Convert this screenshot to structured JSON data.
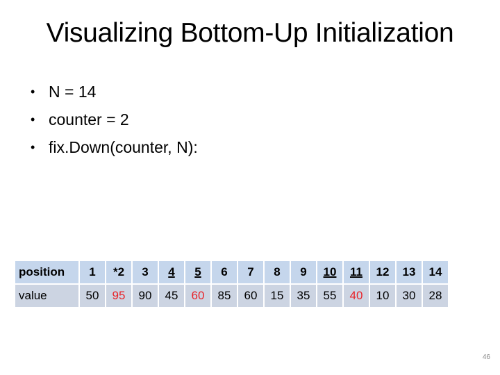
{
  "slide": {
    "title": "Visualizing Bottom-Up Initialization",
    "bullets": [
      "N = 14",
      "counter = 2",
      "fix.Down(counter, N):"
    ],
    "page_number": "46"
  },
  "table": {
    "row_labels": {
      "position": "position",
      "value": "value"
    },
    "positions": [
      {
        "label": "1",
        "underline": false
      },
      {
        "label": "*2",
        "underline": false
      },
      {
        "label": "3",
        "underline": false
      },
      {
        "label": "4",
        "underline": true
      },
      {
        "label": "5",
        "underline": true
      },
      {
        "label": "6",
        "underline": false
      },
      {
        "label": "7",
        "underline": false
      },
      {
        "label": "8",
        "underline": false
      },
      {
        "label": "9",
        "underline": false
      },
      {
        "label": "10",
        "underline": true
      },
      {
        "label": "11",
        "underline": true
      },
      {
        "label": "12",
        "underline": false
      },
      {
        "label": "13",
        "underline": false
      },
      {
        "label": "14",
        "underline": false
      }
    ],
    "values": [
      {
        "v": "50",
        "highlight": false
      },
      {
        "v": "95",
        "highlight": true
      },
      {
        "v": "90",
        "highlight": false
      },
      {
        "v": "45",
        "highlight": false
      },
      {
        "v": "60",
        "highlight": true
      },
      {
        "v": "85",
        "highlight": false
      },
      {
        "v": "60",
        "highlight": false
      },
      {
        "v": "15",
        "highlight": false
      },
      {
        "v": "35",
        "highlight": false
      },
      {
        "v": "55",
        "highlight": false
      },
      {
        "v": "40",
        "highlight": true
      },
      {
        "v": "10",
        "highlight": false
      },
      {
        "v": "30",
        "highlight": false
      },
      {
        "v": "28",
        "highlight": false
      }
    ],
    "colors": {
      "header_bg": "#c5d6ec",
      "row_bg": "#ccd4e2",
      "highlight": "#e8242a"
    }
  }
}
